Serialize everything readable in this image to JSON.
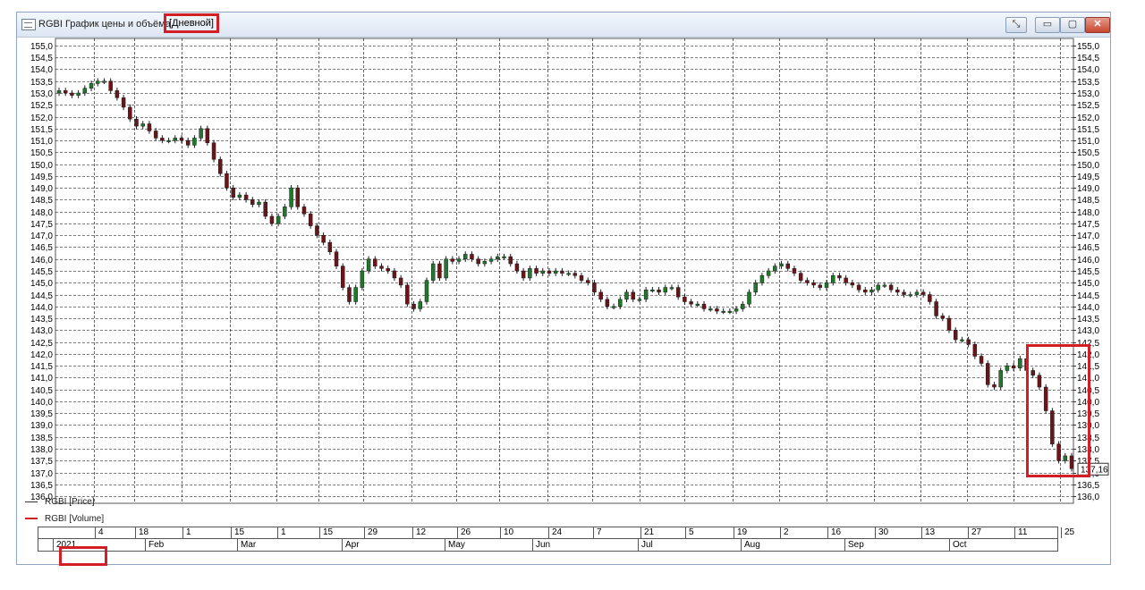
{
  "window": {
    "title": "RGBI График цены и объёма",
    "interval": "[Дневной]",
    "buttons": {
      "tools": "⤡",
      "minimize": "▭",
      "maximize": "▢",
      "close": "✕"
    }
  },
  "colors": {
    "up": "#1e7a2a",
    "down": "#6b1519",
    "grid": "#000000",
    "highlight": "#d21f26",
    "volume_line": "#d21f26"
  },
  "legend": {
    "price": "RGBI [Price]",
    "volume": "RGBI [Volume]"
  },
  "last_price_label": "137,16",
  "time_axis": {
    "date_ticks": [
      "4",
      "18",
      "1",
      "15",
      "1",
      "15",
      "29",
      "12",
      "26",
      "10",
      "24",
      "7",
      "21",
      "5",
      "19",
      "2",
      "16",
      "30",
      "13",
      "27",
      "11",
      "25"
    ],
    "months": [
      "2021",
      "Feb",
      "Mar",
      "Apr",
      "May",
      "Jun",
      "Jul",
      "Aug",
      "Sep",
      "Oct"
    ]
  },
  "chart_data": {
    "type": "candlestick",
    "title": "RGBI График цены и объёма",
    "series_name": "RGBI [Price]",
    "ylim": [
      135.7,
      155.3
    ],
    "y_ticks": [
      "155,0",
      "154,5",
      "154,0",
      "153,5",
      "153,0",
      "152,5",
      "152,0",
      "151,5",
      "151,0",
      "150,5",
      "150,0",
      "149,5",
      "149,0",
      "148,5",
      "148,0",
      "147,5",
      "147,0",
      "146,5",
      "146,0",
      "145,5",
      "145,0",
      "144,5",
      "144,0",
      "143,5",
      "143,0",
      "142,5",
      "142,0",
      "141,5",
      "141,0",
      "140,5",
      "140,0",
      "139,5",
      "139,0",
      "138,5",
      "138,0",
      "137,5",
      "137,0",
      "136,5",
      "136,0"
    ],
    "grid": true,
    "last_value": 137.16,
    "close": [
      153.1,
      153.0,
      152.9,
      153.0,
      153.2,
      153.4,
      153.5,
      153.5,
      153.1,
      152.8,
      152.4,
      151.9,
      151.6,
      151.7,
      151.4,
      151.1,
      151.0,
      151.0,
      151.1,
      151.0,
      150.8,
      151.1,
      151.5,
      150.9,
      150.2,
      149.6,
      149.0,
      148.6,
      148.7,
      148.5,
      148.3,
      148.4,
      147.8,
      147.5,
      147.8,
      148.2,
      149.0,
      148.2,
      147.9,
      147.4,
      147.0,
      146.7,
      146.3,
      145.7,
      144.8,
      144.2,
      144.8,
      145.5,
      146.0,
      145.7,
      145.6,
      145.5,
      145.2,
      144.9,
      144.1,
      143.9,
      144.2,
      145.1,
      145.8,
      145.2,
      146.0,
      145.9,
      146.0,
      146.2,
      146.0,
      145.8,
      145.9,
      146.0,
      146.1,
      146.1,
      145.8,
      145.5,
      145.2,
      145.6,
      145.4,
      145.5,
      145.4,
      145.5,
      145.4,
      145.4,
      145.3,
      145.1,
      145.0,
      144.6,
      144.3,
      144.0,
      144.0,
      144.3,
      144.6,
      144.3,
      144.3,
      144.7,
      144.7,
      144.6,
      144.8,
      144.8,
      144.4,
      144.2,
      144.1,
      144.1,
      143.9,
      143.9,
      143.8,
      143.8,
      143.8,
      143.9,
      144.1,
      144.6,
      145.0,
      145.3,
      145.5,
      145.7,
      145.8,
      145.6,
      145.4,
      145.1,
      145.0,
      144.9,
      144.8,
      145.0,
      145.3,
      145.2,
      145.0,
      144.9,
      144.7,
      144.6,
      144.7,
      144.9,
      144.9,
      144.7,
      144.6,
      144.5,
      144.5,
      144.6,
      144.5,
      144.2,
      143.6,
      143.5,
      143.0,
      142.6,
      142.6,
      142.4,
      141.9,
      141.6,
      140.7,
      140.6,
      141.3,
      141.5,
      141.4,
      141.8,
      141.3,
      141.1,
      140.6,
      139.6,
      138.2,
      137.5,
      137.7,
      137.16
    ]
  }
}
